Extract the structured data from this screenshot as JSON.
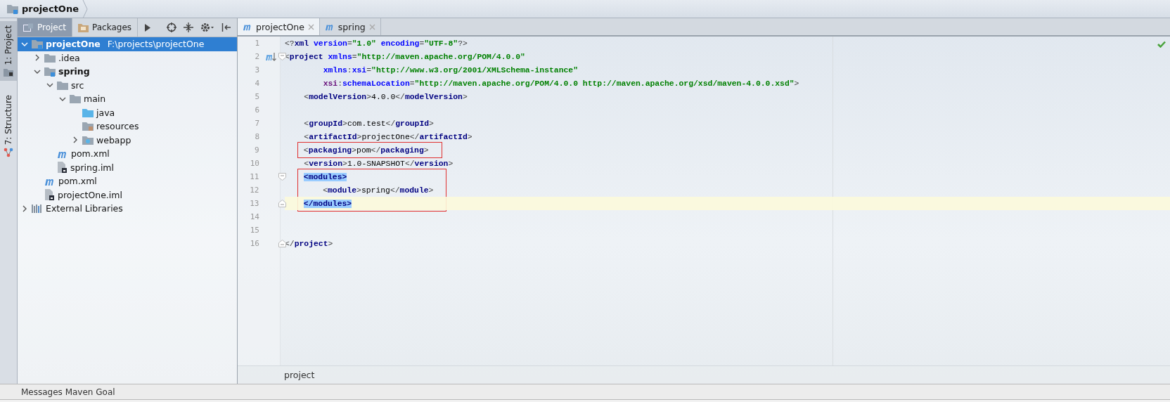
{
  "breadcrumb": {
    "label": "projectOne"
  },
  "tool_strip": [
    {
      "label": "1: Project",
      "kind": "project",
      "selected": true
    },
    {
      "label": "7: Structure",
      "kind": "structure",
      "selected": false
    }
  ],
  "project_panel": {
    "tabs": [
      {
        "label": "Project",
        "selected": true
      },
      {
        "label": "Packages",
        "selected": false
      }
    ],
    "tree": [
      {
        "label": "projectOne",
        "path": "F:\\projects\\projectOne",
        "kind": "module",
        "expanded": true,
        "selected": true,
        "children": [
          {
            "label": ".idea",
            "kind": "folder",
            "expanded": false,
            "selected": false
          },
          {
            "label": "spring",
            "kind": "module",
            "expanded": true,
            "selected": false,
            "children": [
              {
                "label": "src",
                "kind": "folder",
                "expanded": true,
                "selected": false,
                "children": [
                  {
                    "label": "main",
                    "kind": "folder",
                    "expanded": true,
                    "selected": false,
                    "children": [
                      {
                        "label": "java",
                        "kind": "source-folder",
                        "selected": false
                      },
                      {
                        "label": "resources",
                        "kind": "resources-folder",
                        "selected": false
                      },
                      {
                        "label": "webapp",
                        "kind": "web-folder",
                        "expanded": false,
                        "selected": false
                      }
                    ]
                  }
                ]
              },
              {
                "label": "pom.xml",
                "kind": "pom",
                "selected": false
              },
              {
                "label": "spring.iml",
                "kind": "iml",
                "selected": false
              }
            ]
          },
          {
            "label": "pom.xml",
            "kind": "pom",
            "selected": false
          },
          {
            "label": "projectOne.iml",
            "kind": "iml",
            "selected": false
          }
        ]
      },
      {
        "label": "External Libraries",
        "kind": "libraries",
        "expanded": false,
        "selected": false
      }
    ]
  },
  "editor": {
    "tabs": [
      {
        "label": "projectOne",
        "selected": true
      },
      {
        "label": "spring",
        "selected": false
      }
    ],
    "blocks": [
      {
        "kind": "plain",
        "lines": [
          {
            "number": "1",
            "current": false,
            "segments": [
              {
                "kind": "punct",
                "text": "<?"
              },
              {
                "kind": "tag",
                "text": "xml"
              },
              {
                "kind": "attr",
                "text": " version"
              },
              {
                "kind": "punct",
                "text": "="
              },
              {
                "kind": "value",
                "text": "\"1.0\""
              },
              {
                "kind": "attr",
                "text": " encoding"
              },
              {
                "kind": "punct",
                "text": "="
              },
              {
                "kind": "value",
                "text": "\"UTF-8\""
              },
              {
                "kind": "punct",
                "text": "?>"
              }
            ]
          },
          {
            "number": "2",
            "current": false,
            "fold_marker": {
              "kind": "start"
            },
            "gutter_icon": {
              "kind": "maven"
            },
            "segments": [
              {
                "kind": "punct",
                "text": "<"
              },
              {
                "kind": "tag",
                "text": "project"
              },
              {
                "kind": "attr",
                "text": " xmlns"
              },
              {
                "kind": "punct",
                "text": "="
              },
              {
                "kind": "value",
                "text": "\"http://maven.apache.org/POM/4.0.0\""
              }
            ]
          },
          {
            "number": "3",
            "current": false,
            "segments": [
              {
                "kind": "attr",
                "text": "        xmlns"
              },
              {
                "kind": "punct",
                "text": ":"
              },
              {
                "kind": "attr",
                "text": "xsi"
              },
              {
                "kind": "punct",
                "text": "="
              },
              {
                "kind": "value",
                "text": "\"http://www.w3.org/2001/XMLSchema-instance\""
              }
            ]
          },
          {
            "number": "4",
            "current": false,
            "segments": [
              {
                "kind": "ns",
                "text": "        xsi"
              },
              {
                "kind": "punct",
                "text": ":"
              },
              {
                "kind": "attr",
                "text": "schemaLocation"
              },
              {
                "kind": "punct",
                "text": "="
              },
              {
                "kind": "value",
                "text": "\"http://maven.apache.org/POM/4.0.0 http://maven.apache.org/xsd/maven-4.0.0.xsd\""
              },
              {
                "kind": "punct",
                "text": ">"
              }
            ]
          },
          {
            "number": "5",
            "current": false,
            "segments": [
              {
                "kind": "punct",
                "text": "    <"
              },
              {
                "kind": "tag",
                "text": "modelVersion"
              },
              {
                "kind": "punct",
                "text": ">"
              },
              {
                "kind": "text",
                "text": "4.0.0"
              },
              {
                "kind": "punct",
                "text": "</"
              },
              {
                "kind": "tag",
                "text": "modelVersion"
              },
              {
                "kind": "punct",
                "text": ">"
              }
            ]
          },
          {
            "number": "6",
            "current": false
          },
          {
            "number": "7",
            "current": false,
            "segments": [
              {
                "kind": "punct",
                "text": "    <"
              },
              {
                "kind": "tag",
                "text": "groupId"
              },
              {
                "kind": "punct",
                "text": ">"
              },
              {
                "kind": "text",
                "text": "com.test"
              },
              {
                "kind": "punct",
                "text": "</"
              },
              {
                "kind": "tag",
                "text": "groupId"
              },
              {
                "kind": "punct",
                "text": ">"
              }
            ]
          },
          {
            "number": "8",
            "current": false,
            "segments": [
              {
                "kind": "punct",
                "text": "    <"
              },
              {
                "kind": "tag",
                "text": "artifactId"
              },
              {
                "kind": "punct",
                "text": ">"
              },
              {
                "kind": "text",
                "text": "projectOne"
              },
              {
                "kind": "punct",
                "text": "</"
              },
              {
                "kind": "tag",
                "text": "artifactId"
              },
              {
                "kind": "punct",
                "text": ">"
              }
            ]
          }
        ]
      },
      {
        "kind": "boxed",
        "lines": [
          {
            "number": "9",
            "current": false,
            "segments": [
              {
                "kind": "punct",
                "text": "    <"
              },
              {
                "kind": "tag",
                "text": "packaging"
              },
              {
                "kind": "punct",
                "text": ">"
              },
              {
                "kind": "text",
                "text": "pom"
              },
              {
                "kind": "punct",
                "text": "</"
              },
              {
                "kind": "tag",
                "text": "packaging"
              },
              {
                "kind": "punct",
                "text": ">"
              }
            ]
          }
        ]
      },
      {
        "kind": "plain",
        "lines": [
          {
            "number": "10",
            "current": false,
            "segments": [
              {
                "kind": "punct",
                "text": "    <"
              },
              {
                "kind": "tag",
                "text": "version"
              },
              {
                "kind": "punct",
                "text": ">"
              },
              {
                "kind": "text",
                "text": "1.0-SNAPSHOT"
              },
              {
                "kind": "punct",
                "text": "</"
              },
              {
                "kind": "tag",
                "text": "version"
              },
              {
                "kind": "punct",
                "text": ">"
              }
            ]
          }
        ]
      },
      {
        "kind": "boxed",
        "lines": [
          {
            "number": "11",
            "current": false,
            "fold_marker": {
              "kind": "start"
            },
            "segments": [
              {
                "kind": "matched",
                "text": "    <modules>"
              }
            ]
          },
          {
            "number": "12",
            "current": false,
            "segments": [
              {
                "kind": "punct",
                "text": "        <"
              },
              {
                "kind": "tag",
                "text": "module"
              },
              {
                "kind": "punct",
                "text": ">"
              },
              {
                "kind": "text",
                "text": "spring"
              },
              {
                "kind": "punct",
                "text": "</"
              },
              {
                "kind": "tag",
                "text": "module"
              },
              {
                "kind": "punct",
                "text": ">"
              }
            ]
          },
          {
            "number": "13",
            "current": true,
            "fold_marker": {
              "kind": "end"
            },
            "segments": [
              {
                "kind": "matched",
                "text": "    </modules>"
              }
            ]
          }
        ]
      },
      {
        "kind": "plain",
        "lines": [
          {
            "number": "14",
            "current": false
          },
          {
            "number": "15",
            "current": false
          },
          {
            "number": "16",
            "current": false,
            "fold_marker": {
              "kind": "end"
            },
            "segments": [
              {
                "kind": "punct",
                "text": "</"
              },
              {
                "kind": "tag",
                "text": "project"
              },
              {
                "kind": "punct",
                "text": ">"
              }
            ]
          }
        ]
      }
    ],
    "breadcrumb": "project"
  },
  "bottom_bar": {
    "label": "Messages Maven Goal"
  }
}
